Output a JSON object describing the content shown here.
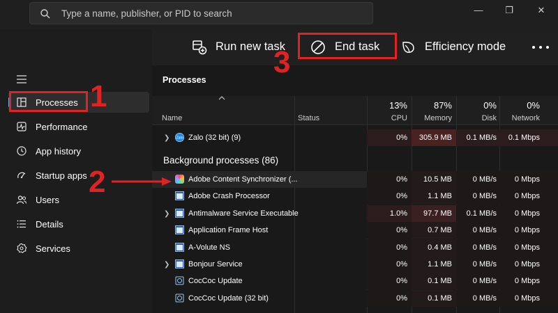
{
  "search": {
    "placeholder": "Type a name, publisher, or PID to search"
  },
  "window_controls": {
    "minimize": "—",
    "restore": "❐",
    "close": "✕"
  },
  "sidebar": {
    "items": [
      {
        "label": "Processes",
        "icon": "processes-icon",
        "active": true
      },
      {
        "label": "Performance",
        "icon": "performance-icon",
        "active": false
      },
      {
        "label": "App history",
        "icon": "app-history-icon",
        "active": false
      },
      {
        "label": "Startup apps",
        "icon": "startup-apps-icon",
        "active": false
      },
      {
        "label": "Users",
        "icon": "users-icon",
        "active": false
      },
      {
        "label": "Details",
        "icon": "details-icon",
        "active": false
      },
      {
        "label": "Services",
        "icon": "services-icon",
        "active": false
      }
    ]
  },
  "toolbar": {
    "run_new_task": "Run new task",
    "end_task": "End task",
    "efficiency_mode": "Efficiency mode",
    "more": "•••"
  },
  "section_title": "Processes",
  "columns": {
    "name": "Name",
    "status": "Status",
    "cpu": {
      "pct": "13%",
      "label": "CPU"
    },
    "memory": {
      "pct": "87%",
      "label": "Memory"
    },
    "disk": {
      "pct": "0%",
      "label": "Disk"
    },
    "network": {
      "pct": "0%",
      "label": "Network"
    }
  },
  "app_row": {
    "name": "Zalo (32 bit) (9)",
    "cpu": "0%",
    "memory": "305.9 MB",
    "disk": "0.1 MB/s",
    "network": "0.1 Mbps",
    "icon": "zalo-icon"
  },
  "background_heading": "Background processes (86)",
  "rows": [
    {
      "name": "Adobe Content Synchronizer (...",
      "cpu": "0%",
      "memory": "10.5 MB",
      "disk": "0 MB/s",
      "network": "0 Mbps",
      "expand": false,
      "icon": "adobe-sync-icon",
      "selected": true
    },
    {
      "name": "Adobe Crash Processor",
      "cpu": "0%",
      "memory": "1.1 MB",
      "disk": "0 MB/s",
      "network": "0 Mbps",
      "expand": false,
      "icon": "app-window-icon"
    },
    {
      "name": "Antimalware Service Executable",
      "cpu": "1.0%",
      "memory": "97.7 MB",
      "disk": "0.1 MB/s",
      "network": "0 Mbps",
      "expand": true,
      "icon": "app-window-icon"
    },
    {
      "name": "Application Frame Host",
      "cpu": "0%",
      "memory": "0.7 MB",
      "disk": "0 MB/s",
      "network": "0 Mbps",
      "expand": false,
      "icon": "app-window-icon"
    },
    {
      "name": "A-Volute NS",
      "cpu": "0%",
      "memory": "0.4 MB",
      "disk": "0 MB/s",
      "network": "0 Mbps",
      "expand": false,
      "icon": "app-window-icon"
    },
    {
      "name": "Bonjour Service",
      "cpu": "0%",
      "memory": "1.1 MB",
      "disk": "0 MB/s",
      "network": "0 Mbps",
      "expand": true,
      "icon": "app-window-icon"
    },
    {
      "name": "CocCoc Update",
      "cpu": "0%",
      "memory": "0.1 MB",
      "disk": "0 MB/s",
      "network": "0 Mbps",
      "expand": false,
      "icon": "coccoc-icon"
    },
    {
      "name": "CocCoc Update (32 bit)",
      "cpu": "0%",
      "memory": "0.1 MB",
      "disk": "0 MB/s",
      "network": "0 Mbps",
      "expand": false,
      "icon": "coccoc-icon"
    }
  ],
  "annotations": {
    "one": "1",
    "two": "2",
    "three": "3"
  },
  "colors": {
    "annotation_red": "#e02222",
    "accent_blue": "#5fb2f2",
    "heat_dark": "#2b1d1d",
    "heat_mid": "#4a2222"
  }
}
